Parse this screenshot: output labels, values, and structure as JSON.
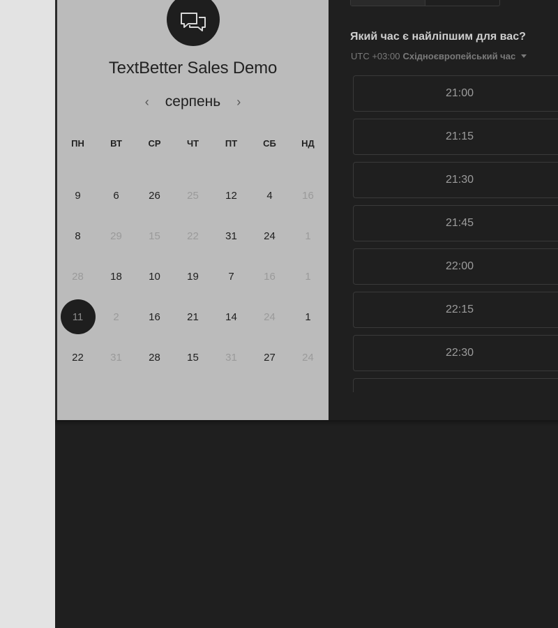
{
  "calendar": {
    "event_title": "TextBetter Sales Demo",
    "month": "серпень",
    "prev_icon": "chevron-left-icon",
    "next_icon": "chevron-right-icon",
    "logo_icon": "chat-bubbles-icon",
    "weekdays": [
      "ПН",
      "ВТ",
      "СР",
      "ЧТ",
      "ПТ",
      "СБ",
      "НД"
    ],
    "weeks": [
      [
        {
          "label": "9",
          "muted": false
        },
        {
          "label": "6",
          "muted": false
        },
        {
          "label": "26",
          "muted": false
        },
        {
          "label": "25",
          "muted": true
        },
        {
          "label": "12",
          "muted": false
        },
        {
          "label": "4",
          "muted": false
        },
        {
          "label": "16",
          "muted": true
        }
      ],
      [
        {
          "label": "8",
          "muted": false
        },
        {
          "label": "29",
          "muted": true
        },
        {
          "label": "15",
          "muted": true
        },
        {
          "label": "22",
          "muted": true
        },
        {
          "label": "31",
          "muted": false
        },
        {
          "label": "24",
          "muted": false
        },
        {
          "label": "1",
          "muted": true
        }
      ],
      [
        {
          "label": "28",
          "muted": true
        },
        {
          "label": "18",
          "muted": false
        },
        {
          "label": "10",
          "muted": false
        },
        {
          "label": "19",
          "muted": false
        },
        {
          "label": "7",
          "muted": false
        },
        {
          "label": "16",
          "muted": true
        },
        {
          "label": "1",
          "muted": true
        }
      ],
      [
        {
          "label": "11",
          "muted": false,
          "selected": true
        },
        {
          "label": "2",
          "muted": true
        },
        {
          "label": "16",
          "muted": false
        },
        {
          "label": "21",
          "muted": false
        },
        {
          "label": "14",
          "muted": false
        },
        {
          "label": "24",
          "muted": true
        },
        {
          "label": "1",
          "muted": false
        }
      ],
      [
        {
          "label": "22",
          "muted": false
        },
        {
          "label": "31",
          "muted": true
        },
        {
          "label": "28",
          "muted": false
        },
        {
          "label": "15",
          "muted": false
        },
        {
          "label": "31",
          "muted": true
        },
        {
          "label": "27",
          "muted": false
        },
        {
          "label": "24",
          "muted": true
        }
      ]
    ]
  },
  "times": {
    "question": "Який час є найліпшим для вас?",
    "timezone_offset": "UTC +03:00",
    "timezone_name": "Східноєвропейський час",
    "slots": [
      "21:00",
      "21:15",
      "21:30",
      "21:45",
      "22:00",
      "22:15",
      "22:30"
    ]
  },
  "colors": {
    "panel_bg": "#bbbbbb",
    "app_bg": "#1f1f1f",
    "selected_day": "#1e1e1e"
  }
}
